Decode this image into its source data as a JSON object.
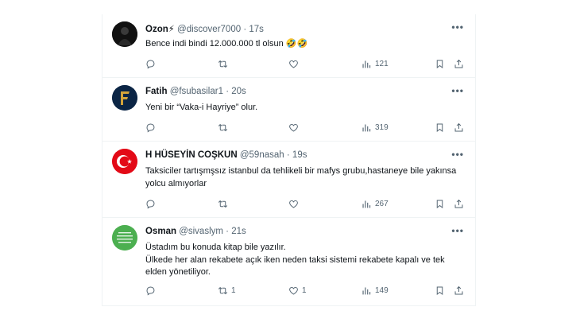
{
  "tweets": [
    {
      "name": "Ozon⚡",
      "handle": "@discover7000",
      "time": "17s",
      "text": "Bence indi bindi 12.000.000 tl olsun 🤣🤣",
      "reply_count": "",
      "retweet_count": "",
      "like_count": "",
      "views": "121",
      "avatar_icon": "dark-figure-avatar"
    },
    {
      "name": "Fatih",
      "handle": "@fsubasilar1",
      "time": "20s",
      "text": "Yeni bir “Vaka-i Hayriye” olur.",
      "reply_count": "",
      "retweet_count": "",
      "like_count": "",
      "views": "319",
      "avatar_icon": "letter-f-logo-avatar"
    },
    {
      "name": "H HÜSEYİN COŞKUN",
      "handle": "@59nasah",
      "time": "19s",
      "text": "Taksiciler tartışmşsız istanbul da tehlikeli bir mafys grubu,hastaneye bile yakınsa yolcu almıyorlar",
      "reply_count": "",
      "retweet_count": "",
      "like_count": "",
      "views": "267",
      "avatar_icon": "turkish-flag-avatar"
    },
    {
      "name": "Osman",
      "handle": "@sivaslym",
      "time": "21s",
      "text_line1": "Üstadım bu konuda kitap bile yazılır.",
      "text_line2": "Ülkede her alan rekabete açık iken neden taksi sistemi rekabete kapalı ve tek elden yönetiliyor.",
      "reply_count": "",
      "retweet_count": "1",
      "like_count": "1",
      "views": "149",
      "avatar_icon": "green-text-avatar"
    }
  ],
  "separator": "·",
  "more_label": "•••",
  "colors": {
    "muted": "#536471",
    "text": "#0f1419",
    "border": "#eff3f4",
    "osman_avatar": "#4caf50",
    "flag_red": "#e30a17"
  }
}
